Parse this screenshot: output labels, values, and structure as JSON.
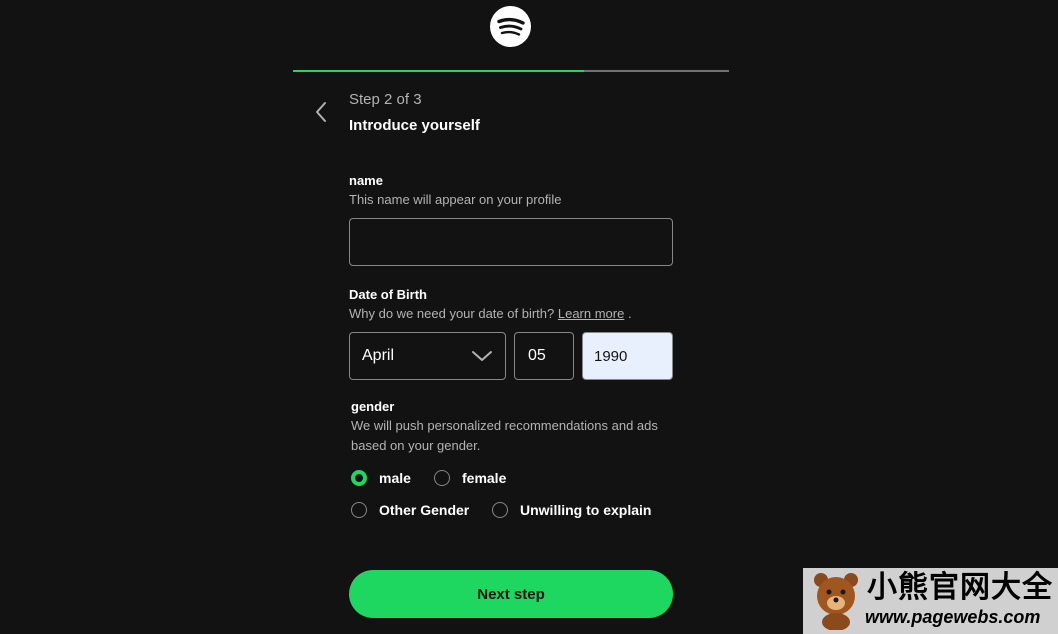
{
  "brand": {
    "logo_icon": "spotify-logo-icon",
    "accent": "#1ed760"
  },
  "progress": {
    "fraction": 0.667
  },
  "header": {
    "back_icon": "chevron-left-icon",
    "step_label": "Step 2 of 3",
    "title": "Introduce yourself"
  },
  "name_field": {
    "label": "name",
    "help": "This name will appear on your profile",
    "value": ""
  },
  "dob": {
    "label": "Date of Birth",
    "help_prefix": "Why do we need your date of birth? ",
    "help_link": "Learn more",
    "help_suffix": " .",
    "month": "April",
    "day": "05",
    "year": "1990",
    "month_icon": "chevron-down-icon"
  },
  "gender": {
    "label": "gender",
    "help": "We will push personalized recommendations and ads based on your gender.",
    "options": [
      {
        "label": "male",
        "checked": true
      },
      {
        "label": "female",
        "checked": false
      },
      {
        "label": "Other Gender",
        "checked": false
      },
      {
        "label": "Unwilling to explain",
        "checked": false
      }
    ]
  },
  "actions": {
    "next_label": "Next step"
  },
  "watermark": {
    "title": "小熊官网大全",
    "url": "www.pagewebs.com",
    "icon": "bear-mascot-icon"
  }
}
